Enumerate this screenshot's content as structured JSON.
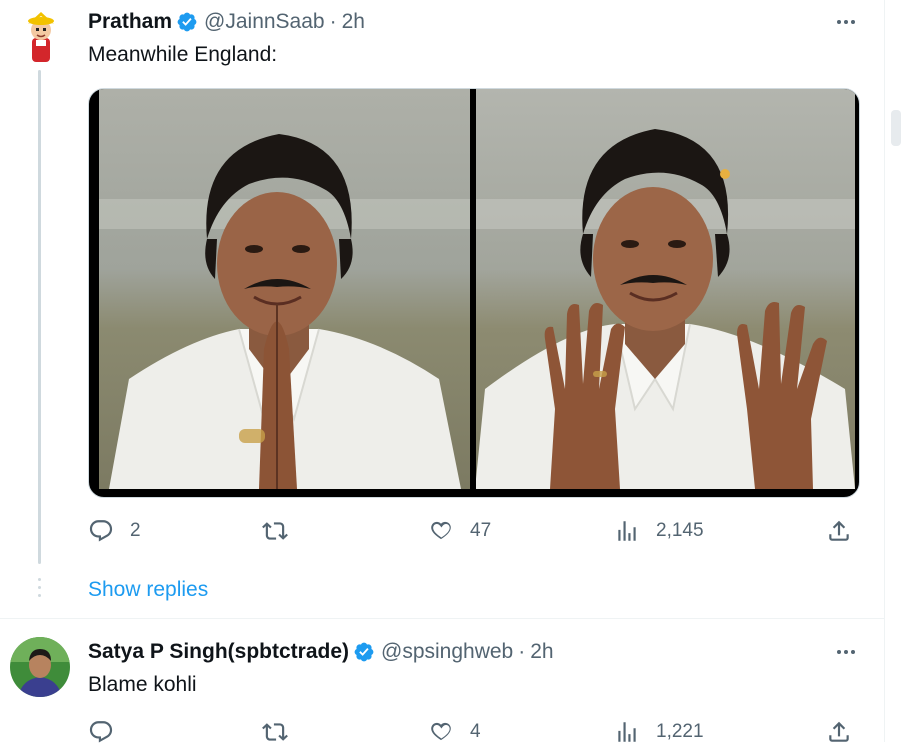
{
  "tweets": [
    {
      "author": {
        "name": "Pratham",
        "handle": "@JainnSaab",
        "time": "2h",
        "verified": true
      },
      "text": "Meanwhile England:",
      "has_media": true,
      "stats": {
        "replies": "2",
        "retweets": "",
        "likes": "47",
        "views": "2,145"
      },
      "show_replies_label": "Show replies"
    },
    {
      "author": {
        "name": "Satya P Singh(spbtctrade)",
        "handle": "@spsinghweb",
        "time": "2h",
        "verified": true
      },
      "text": "Blame kohli",
      "stats": {
        "replies": "",
        "retweets": "",
        "likes": "4",
        "views": "1,221"
      }
    }
  ],
  "separator": "·",
  "colors": {
    "accent": "#1d9bf0",
    "muted": "#536471",
    "text": "#0f1419",
    "border": "#eff3f4"
  },
  "icons": [
    "verified-badge-icon",
    "more-icon",
    "reply-icon",
    "retweet-icon",
    "like-icon",
    "views-icon",
    "share-icon"
  ]
}
